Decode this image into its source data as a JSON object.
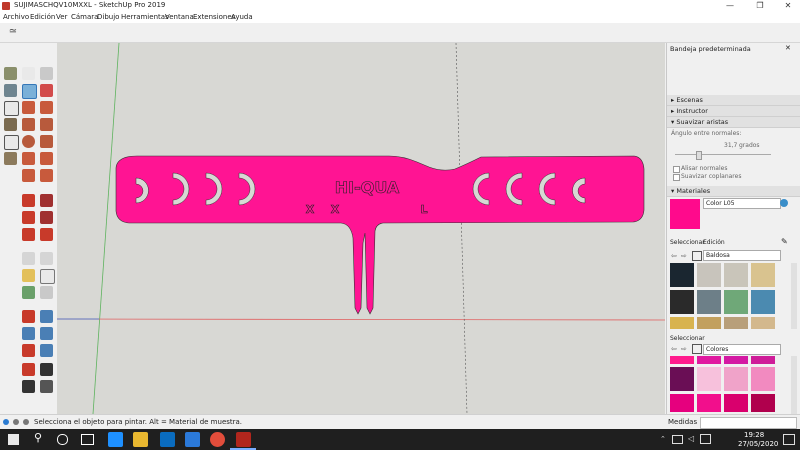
{
  "window": {
    "title": "SUJIMASCHQV10MXXL - SketchUp Pro 2019",
    "minimize": "—",
    "maximize": "❐",
    "close": "✕"
  },
  "menu": [
    "Archivo",
    "Edición",
    "Ver",
    "Cámara",
    "Dibujo",
    "Herramientas",
    "Ventana",
    "Extensiones",
    "Ayuda"
  ],
  "model": {
    "title_text": "HI-QUA",
    "size_marks": [
      "X",
      "X",
      "L"
    ],
    "color": "#ff1493"
  },
  "tray": {
    "title": "Bandeja predeterminada",
    "panels": [
      "Escenas",
      "Instructor",
      "Suavizar aristas"
    ],
    "smooth": {
      "angle_label": "Ángulo entre normales:",
      "angle_value": "31,7",
      "angle_unit": "grados",
      "normals_label": "Alisar normales",
      "coplanar_label": "Suavizar coplanares"
    },
    "materials": {
      "header": "Materiales",
      "color_name": "Color L05",
      "color_hex": "#ff0a8c",
      "tab_select": "Seleccionar",
      "tab_edit": "Edición",
      "category": "Baldosa",
      "lower_header": "Seleccionar",
      "lower_category": "Colores"
    },
    "tile_swatches": [
      "#1a2630",
      "#c8c4bc",
      "#c9c5ba",
      "#d9c38f",
      "#1e2428",
      "#c9c2b6",
      "#bfb6a8",
      "#c8a878",
      "#2a2a2a",
      "#6d7f88",
      "#6fa878",
      "#4b8ab0",
      "#d8b34f",
      "#c2a05e",
      "#b89f7a",
      "#d3b88d"
    ],
    "color_swatches": [
      "#ff1b8d",
      "#e01aa0",
      "#d41aa3",
      "#cf1d99",
      "#6a0e55",
      "#f7c1dc",
      "#f0a3c9",
      "#f28ac0",
      "#e6007e",
      "#f20f8c",
      "#d9006d",
      "#b0004d"
    ]
  },
  "status": {
    "text": "Selecciona el objeto para pintar. Alt = Material de muestra.",
    "measures_label": "Medidas"
  },
  "taskbar": {
    "search_icon": "⚲",
    "time": "19:28",
    "date": "27/05/2020"
  }
}
